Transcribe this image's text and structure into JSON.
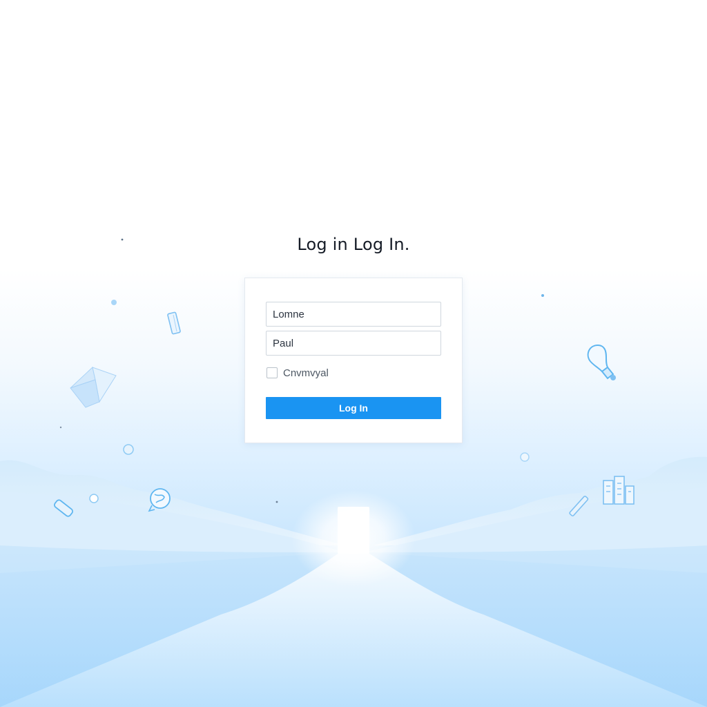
{
  "page": {
    "title": "Log in Log In."
  },
  "form": {
    "username_value": "Lomne",
    "password_value": "Paul",
    "remember_label": "Cnvmvyal",
    "remember_checked": false,
    "submit_label": "Log In"
  },
  "decorations": {
    "icons": [
      "book-icon",
      "bookmark-icon",
      "lightbulb-icon",
      "pencil-icon",
      "bandage-icon",
      "globe-icon",
      "building-icon",
      "hills",
      "glowing-door"
    ]
  },
  "colors": {
    "accent": "#1a94f2",
    "title_text": "#151b26",
    "background_bottom": "#a9d8fc",
    "doodle_stroke": "#5fb6f0"
  }
}
